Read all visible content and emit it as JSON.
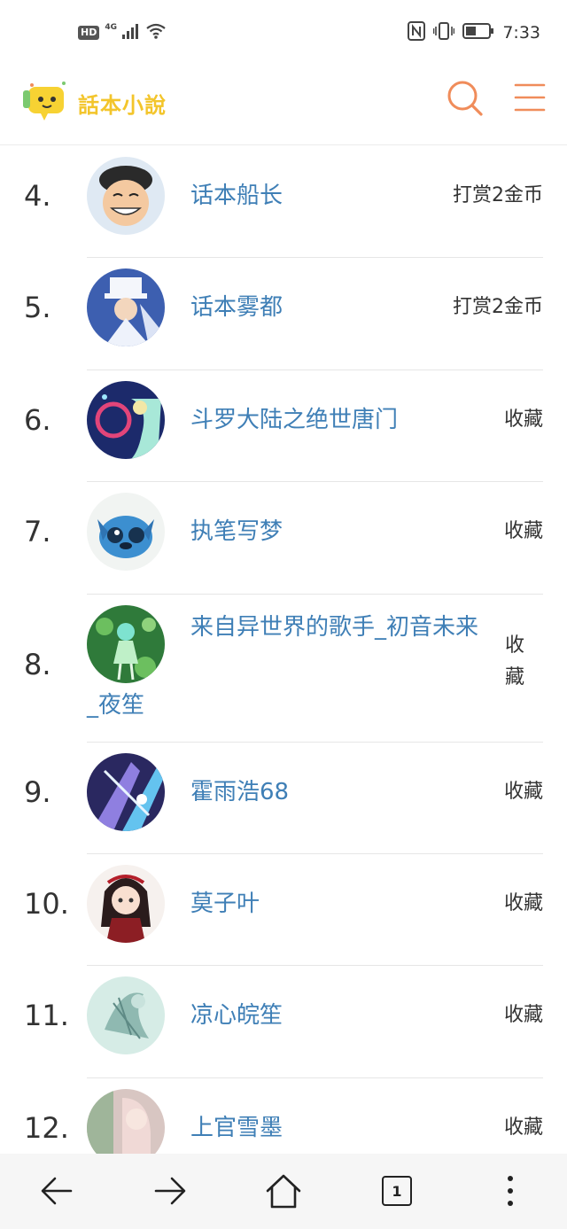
{
  "status_bar": {
    "hd": "HD",
    "network": "4G",
    "time": "7:33",
    "icons": [
      "signal-icon",
      "wifi-icon",
      "nfc-icon",
      "vibrate-icon",
      "battery-icon"
    ]
  },
  "header": {
    "logo_text": "話本小說",
    "icons": [
      "search-icon",
      "menu-icon"
    ],
    "accent_color": "#f08c5a",
    "logo_color": "#f3c52b"
  },
  "rank_list": [
    {
      "rank": "4.",
      "name": "话本船长",
      "action": "打赏2金币"
    },
    {
      "rank": "5.",
      "name": "话本雾都",
      "action": "打赏2金币"
    },
    {
      "rank": "6.",
      "name": "斗罗大陆之绝世唐门",
      "action": "收藏"
    },
    {
      "rank": "7.",
      "name": "执笔写梦",
      "action": "收藏"
    },
    {
      "rank": "8.",
      "name": "来自异世界的歌手_初音未来",
      "name_tail": "_夜笙",
      "action": "收藏"
    },
    {
      "rank": "9.",
      "name": "霍雨浩68",
      "action": "收藏"
    },
    {
      "rank": "10.",
      "name": "莫子叶",
      "action": "收藏"
    },
    {
      "rank": "11.",
      "name": "凉心皖笙",
      "action": "收藏"
    },
    {
      "rank": "12.",
      "name": "上官雪墨",
      "action": "收藏"
    }
  ],
  "bottom_nav": {
    "tab_count": "1",
    "icons": [
      "back-arrow-icon",
      "forward-arrow-icon",
      "home-icon",
      "tabs-icon",
      "more-vertical-icon"
    ]
  },
  "colors": {
    "name_link": "#3f7fb6",
    "text": "#333333",
    "separator": "#e6e6e6"
  }
}
